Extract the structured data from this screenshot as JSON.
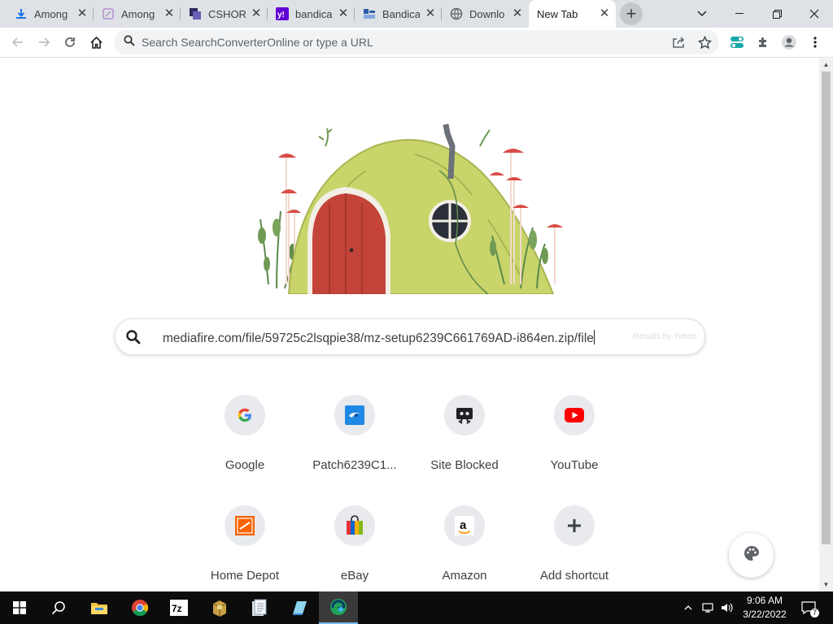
{
  "tabs": [
    {
      "title": "Among",
      "icon": "download-icon"
    },
    {
      "title": "Among",
      "icon": "page-icon"
    },
    {
      "title": "CSHORT",
      "icon": "cshort-icon"
    },
    {
      "title": "bandica",
      "icon": "yahoo-icon"
    },
    {
      "title": "Bandica",
      "icon": "bandicam-icon"
    },
    {
      "title": "Downlo",
      "icon": "globe-icon"
    },
    {
      "title": "New Tab",
      "icon": "none"
    }
  ],
  "omnibox": {
    "placeholder": "Search SearchConverterOnline or type a URL"
  },
  "search": {
    "query": "mediafire.com/file/59725c2lsqpie38/mz-setup6239C661769AD-i864en.zip/file",
    "byline": "Results by Yahoo"
  },
  "shortcuts": [
    {
      "label": "Google",
      "icon": "google-icon"
    },
    {
      "label": "Patch6239C1...",
      "icon": "patch-icon"
    },
    {
      "label": "Site Blocked",
      "icon": "site-blocked-icon"
    },
    {
      "label": "YouTube",
      "icon": "youtube-icon"
    },
    {
      "label": "Home Depot",
      "icon": "home-depot-icon"
    },
    {
      "label": "eBay",
      "icon": "ebay-icon"
    },
    {
      "label": "Amazon",
      "icon": "amazon-icon"
    },
    {
      "label": "Add shortcut",
      "icon": "plus-icon"
    }
  ],
  "taskbar": {
    "apps": [
      "start",
      "search",
      "file-explorer",
      "chrome",
      "7zip",
      "archive",
      "notepad",
      "pen",
      "edge-like-app"
    ],
    "time": "9:06 AM",
    "date": "3/22/2022",
    "notifications_count": "7"
  },
  "colors": {
    "tabstrip": "#dee1e6",
    "youtube_red": "#ff0000",
    "taskbar": "#0c0c0c"
  }
}
